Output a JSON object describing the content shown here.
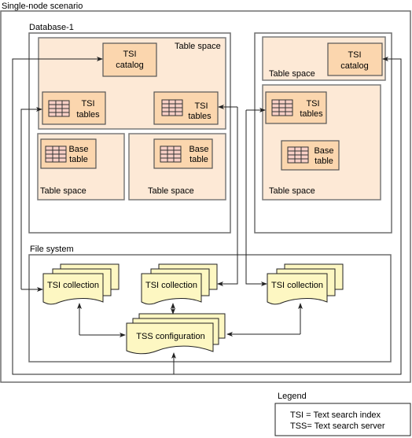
{
  "title": "Single-node scenario",
  "database1": {
    "label": "Database-1",
    "table_space_main": {
      "label": "Table space",
      "catalog": [
        "TSI",
        "catalog"
      ],
      "tsi_tables_left": [
        "TSI",
        "tables"
      ],
      "tsi_tables_right": [
        "TSI",
        "tables"
      ]
    },
    "table_space_left": {
      "label": "Table space",
      "base_table": [
        "Base",
        "table"
      ]
    },
    "table_space_right": {
      "label": "Table space",
      "base_table": [
        "Base",
        "table"
      ]
    }
  },
  "database2": {
    "table_space_top": {
      "label": "Table space",
      "catalog": [
        "TSI",
        "catalog"
      ]
    },
    "table_space_bottom": {
      "label": "Table space",
      "tsi_tables": [
        "TSI",
        "tables"
      ],
      "base_table": [
        "Base",
        "table"
      ]
    }
  },
  "file_system": {
    "label": "File system",
    "collections": [
      "TSI collection",
      "TSI collection",
      "TSI collection"
    ],
    "tss_configuration": "TSS configuration"
  },
  "legend": {
    "label": "Legend",
    "entries": [
      "TSI = Text search index",
      "TSS= Text search server"
    ]
  },
  "colors": {
    "table_space": "#fde9d6",
    "object": "#fbd6ae",
    "document": "#fdf7c2"
  }
}
